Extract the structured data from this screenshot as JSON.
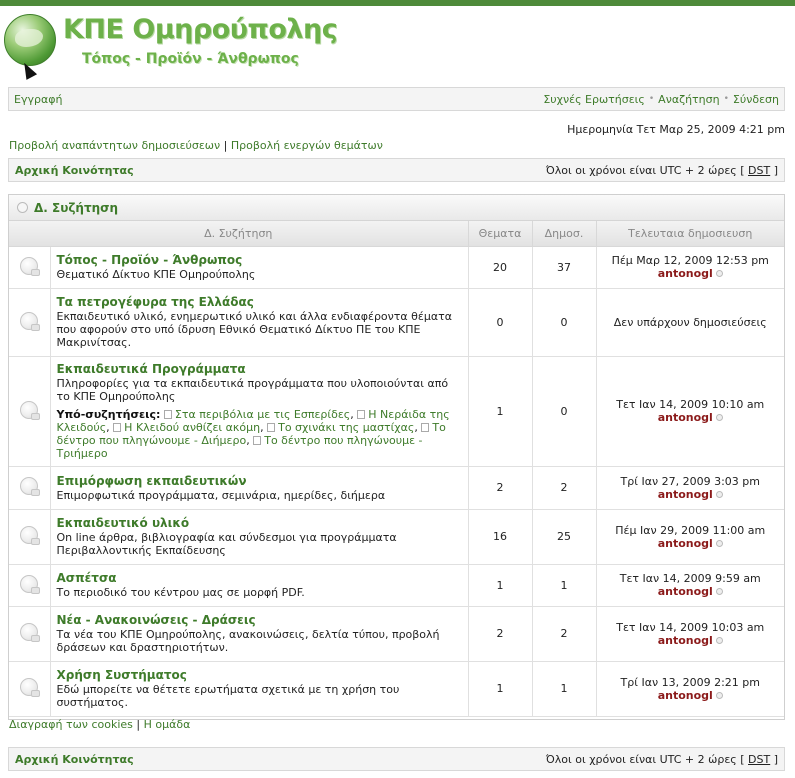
{
  "site": {
    "title": "ΚΠΕ Ομηρούπολης",
    "subtitle": "Τόπος - Προϊόν - Άνθρωπος"
  },
  "nav": {
    "register": "Εγγραφή",
    "faq": "Συχνές Ερωτήσεις",
    "search": "Αναζήτηση",
    "login": "Σύνδεση",
    "separator": "•"
  },
  "datetime": "Ημερομηνία Τετ Μαρ 25, 2009 4:21 pm",
  "quicklinks": {
    "unanswered": "Προβολή αναπάντητων δημοσιεύσεων",
    "active": "Προβολή ενεργών θεμάτων",
    "separator": "|"
  },
  "breadcrumb": {
    "home": "Αρχική Κοινότητας",
    "tz_prefix": "Όλοι οι χρόνοι είναι UTC + 2 ώρες [",
    "tz_dst": "DST",
    "tz_suffix": "]"
  },
  "category": {
    "name": "Δ. Συζήτηση"
  },
  "columns": {
    "forum": "Δ. Συζήτηση",
    "topics": "Θεματα",
    "posts": "Δημοσ.",
    "last_post": "Τελευταια δημοσιευση"
  },
  "forums": [
    {
      "title": "Τόπος - Προϊόν - Άνθρωπος",
      "desc": "Θεματικό Δίκτυο ΚΠΕ Ομηρούπολης",
      "topics": "20",
      "posts": "37",
      "last_date": "Πέμ Μαρ 12, 2009 12:53 pm",
      "last_user": "antonogl"
    },
    {
      "title": "Τα πετρογέφυρα της Ελλάδας",
      "desc": "Εκπαιδευτικό υλικό, ενημερωτικό υλικό και άλλα ενδιαφέροντα θέματα που αφορούν στο υπό ίδρυση Εθνικό Θεματικό Δίκτυο ΠΕ του ΚΠΕ Μακρινίτσας.",
      "topics": "0",
      "posts": "0",
      "last_none": "Δεν υπάρχουν δημοσιεύσεις"
    },
    {
      "title": "Εκπαιδευτικά Προγράμματα",
      "desc": "Πληροφορίες για τα εκπαιδευτικά προγράμματα που υλοποιούνται από το ΚΠΕ Ομηρούπολης",
      "subforums_label": "Υπό-συζητήσεις:",
      "subforums": [
        "Στα περιβόλια με τις Εσπερίδες",
        "Η Νεράιδα της Κλειδούς",
        "Η Κλειδού ανθίζει ακόμη",
        "Το σχινάκι της μαστίχας",
        "Το δέντρο που πληγώνουμε - Διήμερο",
        "Το δέντρο που πληγώνουμε - Τριήμερο"
      ],
      "topics": "1",
      "posts": "0",
      "last_date": "Τετ Ιαν 14, 2009 10:10 am",
      "last_user": "antonogl"
    },
    {
      "title": "Επιμόρφωση εκπαιδευτικών",
      "desc": "Επιμορφωτικά προγράμματα, σεμινάρια, ημερίδες, διήμερα",
      "topics": "2",
      "posts": "2",
      "last_date": "Τρί Ιαν 27, 2009 3:03 pm",
      "last_user": "antonogl"
    },
    {
      "title": "Εκπαιδευτικό υλικό",
      "desc": "On line άρθρα, βιβλιογραφία και σύνδεσμοι για προγράμματα Περιβαλλοντικής Εκπαίδευσης",
      "topics": "16",
      "posts": "25",
      "last_date": "Πέμ Ιαν 29, 2009 11:00 am",
      "last_user": "antonogl"
    },
    {
      "title": "Ασπέτσα",
      "desc": "Το περιοδικό του κέντρου μας σε μορφή PDF.",
      "topics": "1",
      "posts": "1",
      "last_date": "Τετ Ιαν 14, 2009 9:59 am",
      "last_user": "antonogl"
    },
    {
      "title": "Νέα - Ανακοινώσεις - Δράσεις",
      "desc": "Τα νέα του ΚΠΕ Ομηρούπολης, ανακοινώσεις, δελτία τύπου, προβολή δράσεων και δραστηριοτήτων.",
      "topics": "2",
      "posts": "2",
      "last_date": "Τετ Ιαν 14, 2009 10:03 am",
      "last_user": "antonogl"
    },
    {
      "title": "Χρήση Συστήματος",
      "desc": "Εδώ μπορείτε να θέτετε ερωτήματα σχετικά με τη χρήση του συστήματος.",
      "topics": "1",
      "posts": "1",
      "last_date": "Τρί Ιαν 13, 2009 2:21 pm",
      "last_user": "antonogl"
    }
  ],
  "footer": {
    "delete_cookies": "Διαγραφή των cookies",
    "team": "Η ομάδα",
    "separator": "|"
  },
  "colors": {
    "brand_green": "#3e7b2a",
    "username": "#8b1a1a"
  },
  "icons": {
    "logo": "globe-logo-icon",
    "forum_status": "forum-read-icon",
    "subforum": "subforum-icon",
    "goto_last_post": "goto-last-post-icon"
  }
}
